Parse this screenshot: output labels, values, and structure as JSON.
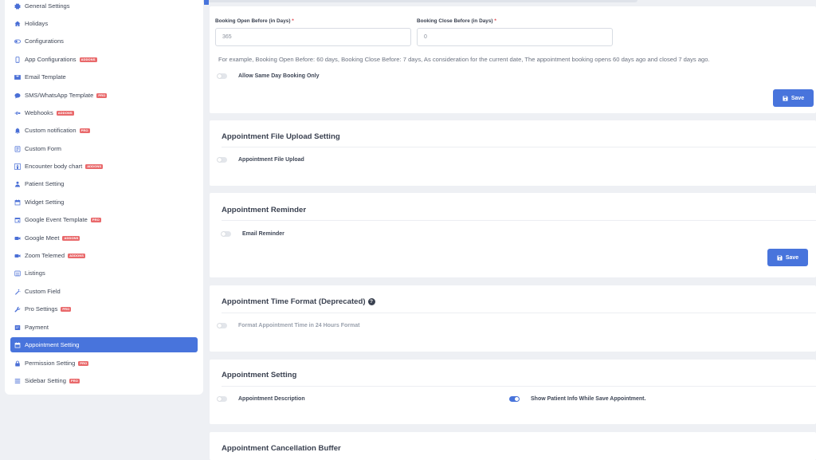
{
  "sidebar": {
    "items": [
      {
        "label": "General Settings",
        "icon": "gears-icon",
        "badge": ""
      },
      {
        "label": "Holidays",
        "icon": "home-icon",
        "badge": ""
      },
      {
        "label": "Configurations",
        "icon": "toggle-icon",
        "badge": ""
      },
      {
        "label": "App Configurations",
        "icon": "mobile-icon",
        "badge": "ADDONS"
      },
      {
        "label": "Email Template",
        "icon": "envelope-icon",
        "badge": ""
      },
      {
        "label": "SMS/WhatsApp Template",
        "icon": "chat-icon",
        "badge": "PRO"
      },
      {
        "label": "Webhooks",
        "icon": "usb-icon",
        "badge": "ADDONS"
      },
      {
        "label": "Custom notification",
        "icon": "bell-icon",
        "badge": "PRO"
      },
      {
        "label": "Custom Form",
        "icon": "form-icon",
        "badge": ""
      },
      {
        "label": "Encounter body chart",
        "icon": "body-chart-icon",
        "badge": "ADDONS"
      },
      {
        "label": "Patient Setting",
        "icon": "user-icon",
        "badge": ""
      },
      {
        "label": "Widget Setting",
        "icon": "calendar-icon",
        "badge": ""
      },
      {
        "label": "Google Event Template",
        "icon": "calendar-event-icon",
        "badge": "PRO"
      },
      {
        "label": "Google Meet",
        "icon": "video-icon",
        "badge": "ADDONS"
      },
      {
        "label": "Zoom Telemed",
        "icon": "video-icon",
        "badge": "ADDONS"
      },
      {
        "label": "Listings",
        "icon": "list-icon",
        "badge": ""
      },
      {
        "label": "Custom Field",
        "icon": "magic-icon",
        "badge": ""
      },
      {
        "label": "Pro Settings",
        "icon": "wrench-icon",
        "badge": "PRO"
      },
      {
        "label": "Payment",
        "icon": "payment-icon",
        "badge": ""
      },
      {
        "label": "Appointment Setting",
        "icon": "calendar-icon",
        "badge": ""
      },
      {
        "label": "Permission Setting",
        "icon": "lock-icon",
        "badge": "PRO"
      },
      {
        "label": "Sidebar Setting",
        "icon": "bars-icon",
        "badge": "PRO"
      }
    ]
  },
  "booking": {
    "open_label": "Booking Open Before (in Days)",
    "open_value": "365",
    "close_label": "Booking Close Before (in Days)",
    "close_value": "0",
    "required_mark": "*",
    "help": "For example, Booking Open Before: 60 days, Booking Close Before: 7 days, As consideration for the current date, The appointment booking opens 60 days ago and closed 7 days ago.",
    "same_day_label": "Allow Same Day Booking Only",
    "same_day_on": false
  },
  "save_label": "Save",
  "file_upload": {
    "title": "Appointment File Upload Setting",
    "toggle_label": "Appointment File Upload"
  },
  "reminder": {
    "title": "Appointment Reminder",
    "toggle_label": "Email Reminder"
  },
  "time_format": {
    "title": "Appointment Time Format (Deprecated)",
    "help_glyph": "?",
    "toggle_label": "Format Appointment Time in 24 Hours Format"
  },
  "appointment_setting": {
    "title": "Appointment Setting",
    "description_label": "Appointment Description",
    "patient_info_label": "Show Patient Info While Save Appointment."
  },
  "cancellation": {
    "title": "Appointment Cancellation Buffer"
  },
  "colors": {
    "accent": "#4874dc",
    "badge": "#e9696b",
    "required": "#e0464e"
  }
}
